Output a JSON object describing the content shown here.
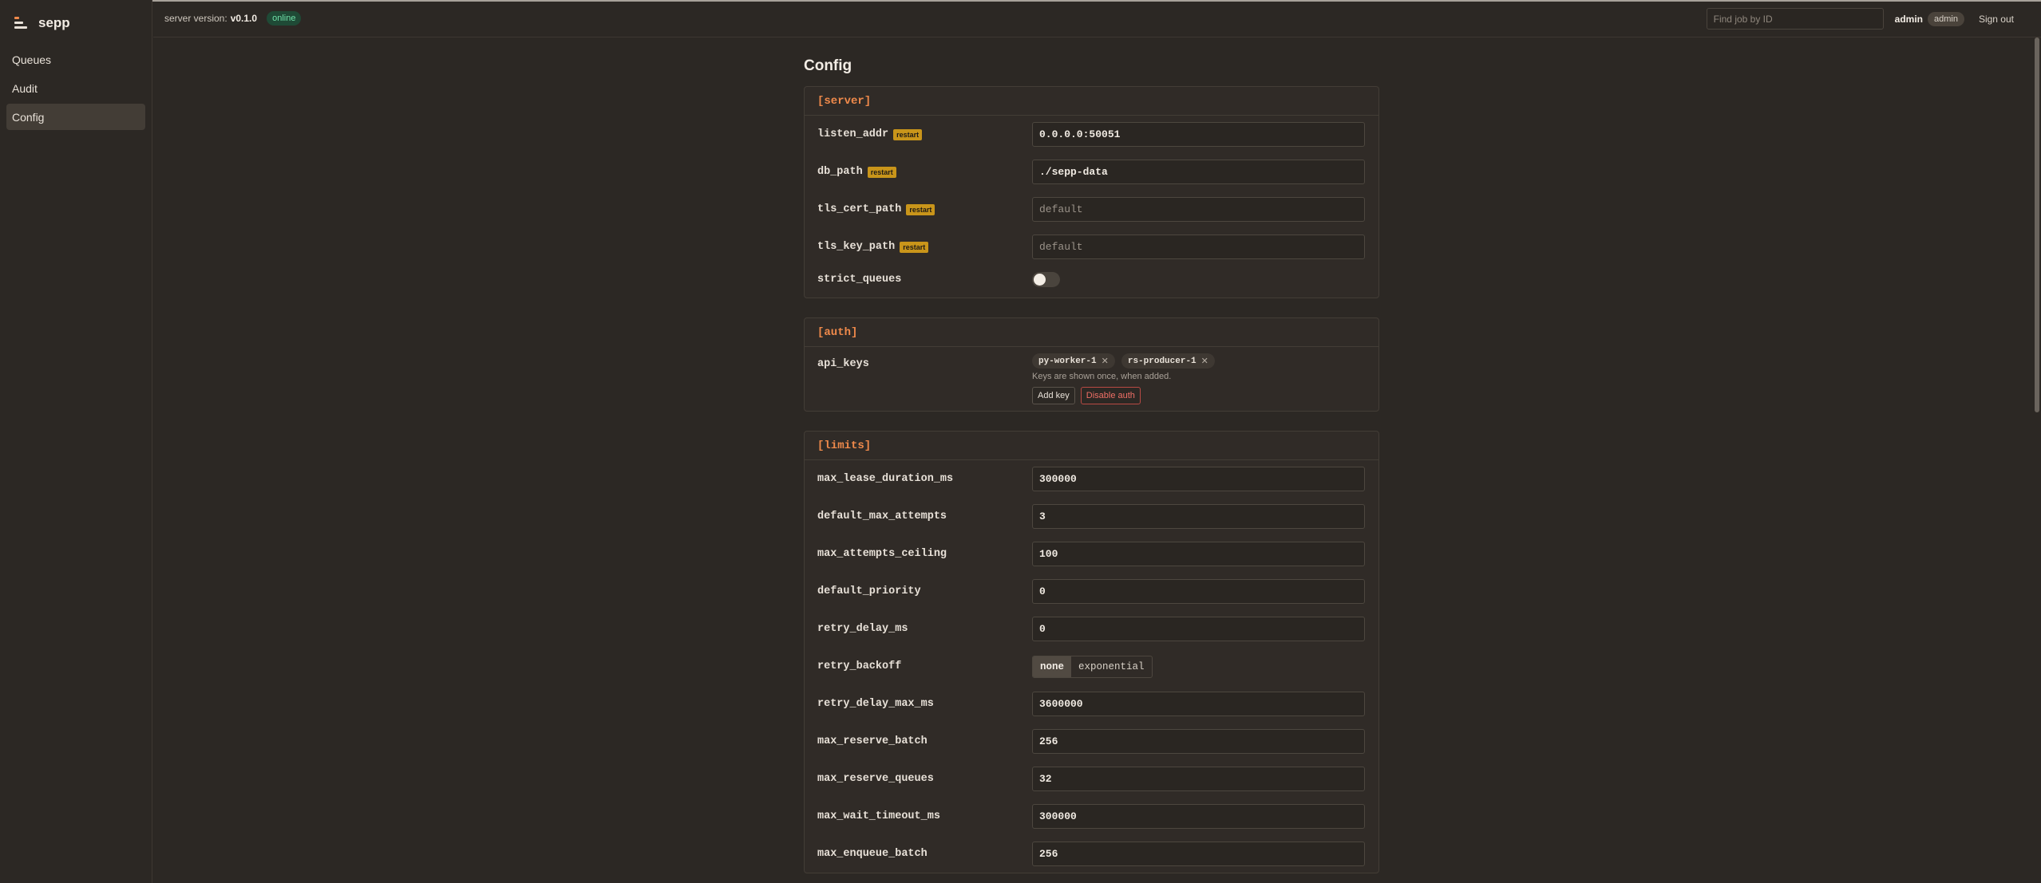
{
  "app": {
    "name": "sepp"
  },
  "sidebar": {
    "items": [
      {
        "label": "Queues"
      },
      {
        "label": "Audit"
      },
      {
        "label": "Config"
      }
    ]
  },
  "topbar": {
    "server_label": "server version:",
    "server_version": "v0.1.0",
    "status": "online",
    "search_placeholder": "Find job by ID",
    "user": "admin",
    "role": "admin",
    "signout": "Sign out"
  },
  "page": {
    "title": "Config"
  },
  "badge": {
    "restart": "restart"
  },
  "server": {
    "header": "[server]",
    "listen_addr": {
      "label": "listen_addr",
      "value": "0.0.0.0:50051"
    },
    "db_path": {
      "label": "db_path",
      "value": "./sepp-data"
    },
    "tls_cert_path": {
      "label": "tls_cert_path",
      "placeholder": "default"
    },
    "tls_key_path": {
      "label": "tls_key_path",
      "placeholder": "default"
    },
    "strict_queues": {
      "label": "strict_queues"
    }
  },
  "auth": {
    "header": "[auth]",
    "label": "api_keys",
    "keys": [
      "py-worker-1",
      "rs-producer-1"
    ],
    "note": "Keys are shown once, when added.",
    "add_key": "Add key",
    "disable_auth": "Disable auth"
  },
  "limits": {
    "header": "[limits]",
    "rows": [
      {
        "label": "max_lease_duration_ms",
        "value": "300000"
      },
      {
        "label": "default_max_attempts",
        "value": "3"
      },
      {
        "label": "max_attempts_ceiling",
        "value": "100"
      },
      {
        "label": "default_priority",
        "value": "0"
      },
      {
        "label": "retry_delay_ms",
        "value": "0"
      }
    ],
    "retry_backoff": {
      "label": "retry_backoff",
      "options": [
        "none",
        "exponential"
      ]
    },
    "rows2": [
      {
        "label": "retry_delay_max_ms",
        "value": "3600000"
      },
      {
        "label": "max_reserve_batch",
        "value": "256"
      },
      {
        "label": "max_reserve_queues",
        "value": "32"
      },
      {
        "label": "max_wait_timeout_ms",
        "value": "300000"
      },
      {
        "label": "max_enqueue_batch",
        "value": "256"
      }
    ]
  }
}
